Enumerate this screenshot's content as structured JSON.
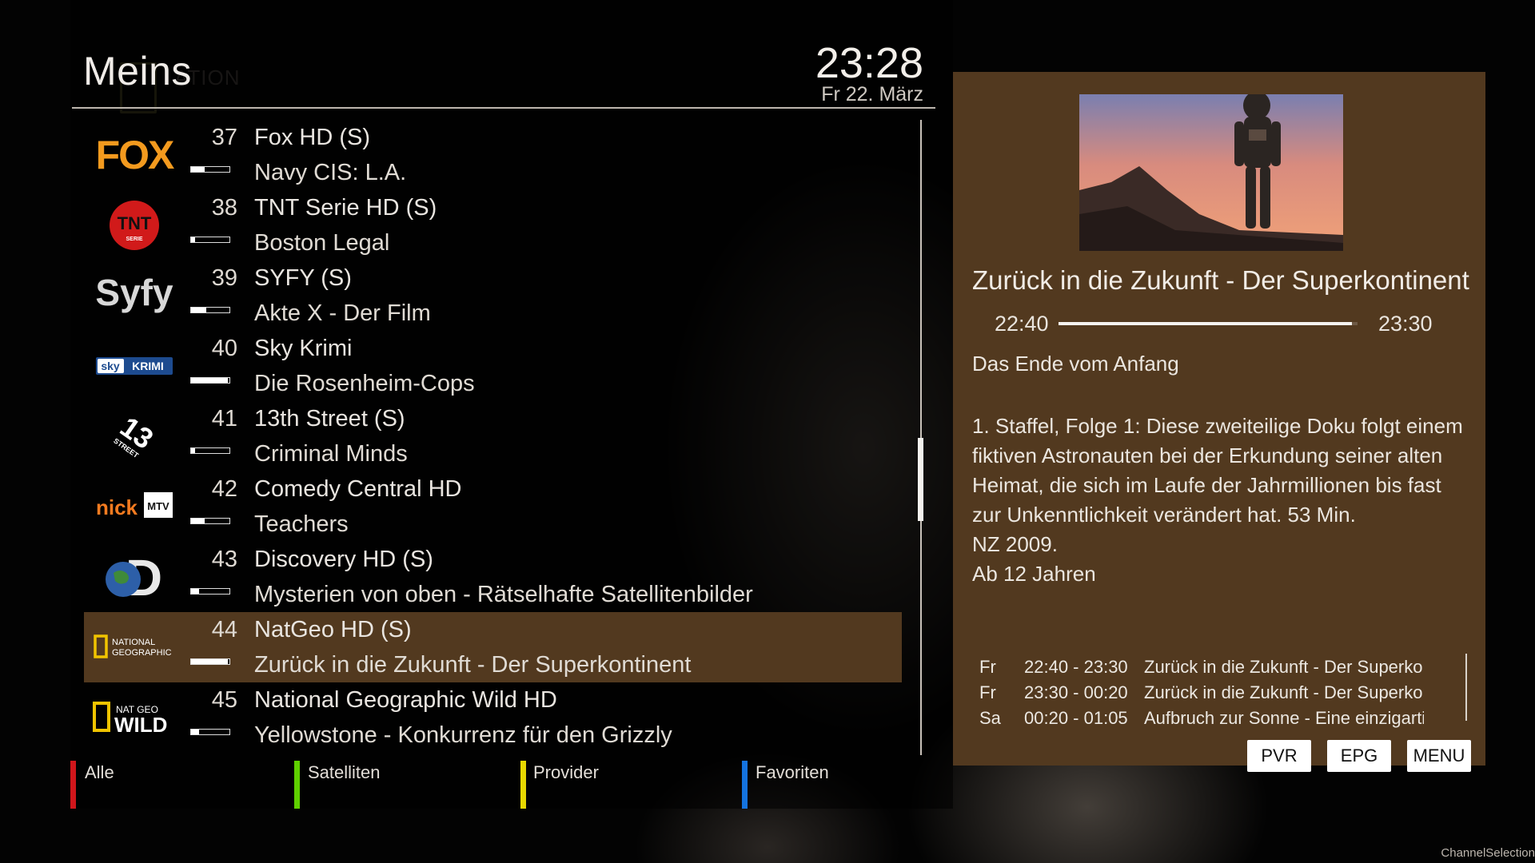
{
  "header": {
    "title": "Meins",
    "ghost_text": "ATION",
    "clock": "23:28",
    "date": "Fr 22. März"
  },
  "channels": [
    {
      "number": "37",
      "name": "Fox HD (S)",
      "program": "Navy CIS: L.A.",
      "progress": 0.35,
      "logo": "fox-logo",
      "logo_text": "FOX"
    },
    {
      "number": "38",
      "name": "TNT Serie HD (S)",
      "program": "Boston Legal",
      "progress": 0.1,
      "logo": "tnt-serie-logo",
      "logo_text": "TNT",
      "logo_subtext": "SERIE"
    },
    {
      "number": "39",
      "name": "SYFY (S)",
      "program": "Akte X - Der Film",
      "progress": 0.4,
      "logo": "syfy-logo",
      "logo_text": "Syfy"
    },
    {
      "number": "40",
      "name": "Sky Krimi",
      "program": "Die Rosenheim-Cops",
      "progress": 0.95,
      "logo": "sky-krimi-logo",
      "logo_text": "sky",
      "logo_subtext": "KRIMI"
    },
    {
      "number": "41",
      "name": "13th Street (S)",
      "program": "Criminal Minds",
      "progress": 0.1,
      "logo": "13th-street-logo",
      "logo_text": "13",
      "logo_subtext": "STREET"
    },
    {
      "number": "42",
      "name": "Comedy Central HD",
      "program": "Teachers",
      "progress": 0.35,
      "logo": "nick-mtv-logo",
      "logo_text": "nick",
      "logo_subtext": "MTV"
    },
    {
      "number": "43",
      "name": "Discovery HD (S)",
      "program": "Mysterien von oben - Rätselhafte Satellitenbilder",
      "progress": 0.2,
      "logo": "discovery-logo",
      "logo_text": "D"
    },
    {
      "number": "44",
      "name": "NatGeo HD (S)",
      "program": "Zurück in die Zukunft - Der Superkontinent",
      "progress": 0.95,
      "logo": "national-geographic-logo",
      "logo_text": "NATIONAL",
      "logo_subtext": "GEOGRAPHIC",
      "selected": true
    },
    {
      "number": "45",
      "name": "National Geographic Wild HD",
      "program": "Yellowstone - Konkurrenz für den Grizzly",
      "progress": 0.2,
      "logo": "nat-geo-wild-logo",
      "logo_text": "NAT GEO",
      "logo_subtext": "WILD"
    }
  ],
  "color_keys": [
    {
      "label": "Alle",
      "color": "#d0161b"
    },
    {
      "label": "Satelliten",
      "color": "#5fd000"
    },
    {
      "label": "Provider",
      "color": "#e8d800"
    },
    {
      "label": "Favoriten",
      "color": "#1473e0"
    }
  ],
  "info": {
    "title": "Zurück in die Zukunft - Der Superkontinent",
    "start": "22:40",
    "end": "23:30",
    "progress": 0.98,
    "subtitle": "Das Ende vom Anfang",
    "description_lines": [
      "1. Staffel, Folge 1: Diese zweiteilige Doku folgt einem",
      "fiktiven Astronauten bei der Erkundung seiner alten",
      "Heimat, die sich im Laufe der Jahrmillionen bis fast",
      "zur Unkenntlichkeit verändert hat. 53 Min.",
      "NZ 2009.",
      "Ab 12 Jahren"
    ],
    "epg": [
      {
        "day": "Fr",
        "time": "22:40 - 23:30",
        "title": "Zurück in die Zukunft - Der Superkontinent"
      },
      {
        "day": "Fr",
        "time": "23:30 - 00:20",
        "title": "Zurück in die Zukunft - Der Superkontinent"
      },
      {
        "day": "Sa",
        "time": "00:20 - 01:05",
        "title": "Aufbruch zur Sonne - Eine einzigartige"
      }
    ],
    "buttons": {
      "pvr": "PVR",
      "epg": "EPG",
      "menu": "MENU"
    }
  },
  "screen_name": "ChannelSelection",
  "colors": {
    "accent": "#52391f",
    "background": "#000000"
  }
}
